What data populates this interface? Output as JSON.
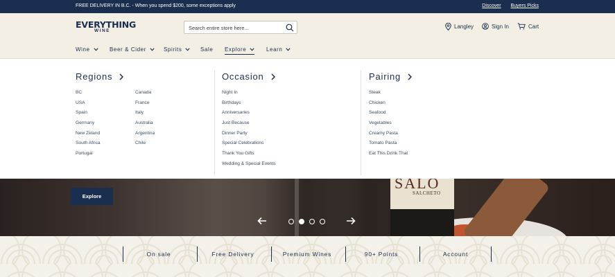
{
  "topbar": {
    "promo": "FREE DELIVERY IN B.C. - When you spend $200, some exceptions apply",
    "links": [
      "Discover",
      "Buyers Picks"
    ]
  },
  "header": {
    "logo_line1": "EVERYTHING",
    "logo_line2": "WINE",
    "search_placeholder": "Search entire store here...",
    "location": "Langley",
    "sign_in": "Sign In",
    "cart": "Cart"
  },
  "nav": {
    "items": [
      "Wine",
      "Beer & Cider",
      "Spirits",
      "Sale",
      "Explore",
      "Learn"
    ],
    "active": "Explore"
  },
  "mega": {
    "regions": {
      "title": "Regions",
      "col1": [
        "BC",
        "USA",
        "Spain",
        "Germany",
        "New Zeland",
        "South Africa",
        "Portugal"
      ],
      "col2": [
        "Canada",
        "France",
        "Italy",
        "Australia",
        "Argentina",
        "Chile"
      ]
    },
    "occasion": {
      "title": "Occasion",
      "items": [
        "Night In",
        "Birthdays",
        "Anniversaries",
        "Just Because",
        "Dinner Party",
        "Special Celebrations",
        "Thank You Gifts",
        "Wedding & Special Events"
      ]
    },
    "pairing": {
      "title": "Pairing",
      "items": [
        "Steak",
        "Chicken",
        "Seafood",
        "Vegetables",
        "Creamy Pasta",
        "Tomato Pasta",
        "Eat This Drink That"
      ]
    }
  },
  "hero": {
    "button": "Explore",
    "bottle_label_big": "SALO",
    "bottle_label_small": "SALCHETO",
    "slides": 4,
    "active_slide": 2
  },
  "features": [
    "On sale",
    "Free Delivery",
    "Premium Wines",
    "90+ Points",
    "Account"
  ],
  "colors": {
    "navy": "#1a2e4f",
    "cream": "#f3efe4"
  }
}
